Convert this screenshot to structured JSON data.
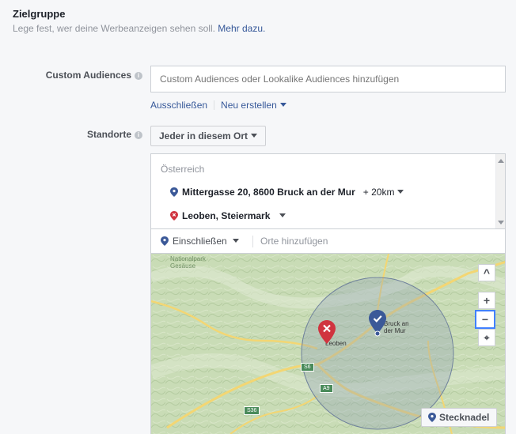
{
  "section": {
    "title": "Zielgruppe",
    "subtitle": "Lege fest, wer deine Werbeanzeigen sehen soll.",
    "learn_more": "Mehr dazu."
  },
  "custom_audiences": {
    "label": "Custom Audiences",
    "placeholder": "Custom Audiences oder Lookalike Audiences hinzufügen",
    "exclude_link": "Ausschließen",
    "create_link": "Neu erstellen"
  },
  "locations": {
    "label": "Standorte",
    "scope_dropdown": "Jeder in diesem Ort",
    "country": "Österreich",
    "items": [
      {
        "name": "Mittergasse 20, 8600 Bruck an der Mur",
        "radius": "+ 20km",
        "type": "include",
        "color": "#3b5998"
      },
      {
        "name": "Leoben, Steiermark",
        "type": "exclude",
        "color": "#d0343f"
      }
    ],
    "include_mode": "Einschließen",
    "add_placeholder": "Orte hinzufügen"
  },
  "map": {
    "labels": {
      "park": "Nationalpark\nGesäuse",
      "leoben": "Leoben",
      "bruck": "Bruck an\nder Mur"
    },
    "road_shields": [
      "S6",
      "A9",
      "S36"
    ],
    "controls": {
      "collapse": "^",
      "zoom_in": "+",
      "zoom_out": "−",
      "fit": "⌖"
    },
    "pin_button": "Stecknadel",
    "colors": {
      "include_pin": "#3b5998",
      "exclude_pin": "#d0343f",
      "radius": "#8fa0b8"
    }
  }
}
